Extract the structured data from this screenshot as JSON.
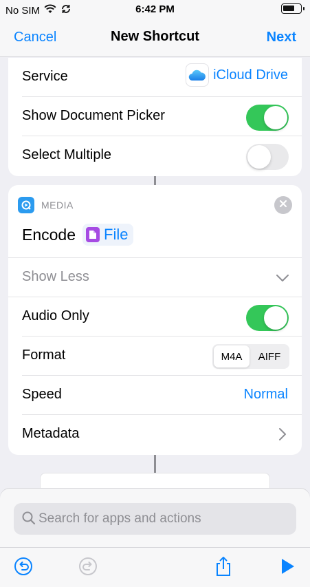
{
  "status_bar": {
    "carrier": "No SIM",
    "time": "6:42 PM"
  },
  "nav": {
    "cancel": "Cancel",
    "title": "New Shortcut",
    "next": "Next"
  },
  "get_file_action": {
    "service_label": "Service",
    "service_value": "iCloud Drive",
    "show_picker_label": "Show Document Picker",
    "show_picker_on": true,
    "select_multiple_label": "Select Multiple",
    "select_multiple_on": false
  },
  "encode_action": {
    "category": "MEDIA",
    "verb": "Encode",
    "input_token": "File",
    "show_less": "Show Less",
    "audio_only_label": "Audio Only",
    "audio_only_on": true,
    "format_label": "Format",
    "format_options": [
      "M4A",
      "AIFF"
    ],
    "format_selected": "M4A",
    "speed_label": "Speed",
    "speed_value": "Normal",
    "metadata_label": "Metadata"
  },
  "search": {
    "placeholder": "Search for apps and actions"
  },
  "colors": {
    "accent": "#0a84ff",
    "toggle_on": "#34c759",
    "media_icon": "#2b9bef",
    "file_token_icon": "#a64be3"
  },
  "icons": [
    "wifi-icon",
    "sync-icon",
    "battery-icon",
    "icloud-icon",
    "media-icon",
    "close-icon",
    "file-icon",
    "chevron-down-icon",
    "chevron-right-icon",
    "search-icon",
    "undo-icon",
    "redo-icon",
    "share-icon",
    "play-icon"
  ]
}
